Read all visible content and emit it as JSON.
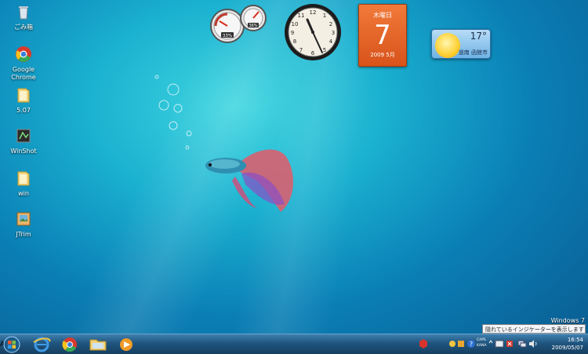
{
  "desktop": {
    "icons": [
      {
        "label": "ごみ箱",
        "icon": "recycle-bin-icon"
      },
      {
        "label": "Google Chrome",
        "icon": "chrome-icon"
      },
      {
        "label": "5.07",
        "icon": "folder-icon"
      },
      {
        "label": "WinShot",
        "icon": "winshot-icon"
      },
      {
        "label": "win",
        "icon": "folder-icon"
      },
      {
        "label": "JTrim",
        "icon": "jtrim-icon"
      }
    ],
    "watermark": "Windows 7"
  },
  "gadgets": {
    "meter": {
      "cpu": "33%",
      "memory": "36%"
    },
    "clock": {
      "hour": 11,
      "minute": 54
    },
    "calendar": {
      "weekday": "木曜日",
      "day": "7",
      "year_month": "2009 5月"
    },
    "weather": {
      "temp": "17°",
      "city": "道南 函館市"
    }
  },
  "tooltip": "隠れているインジケーターを表示します",
  "taskbar": {
    "pinned": [
      "start-orb",
      "internet-explorer",
      "chrome",
      "explorer",
      "media-player"
    ],
    "tray": {
      "ime": "A 般",
      "caps": "CAPS",
      "kana": "KANA",
      "time": "16:54",
      "date": "2009/05/07"
    }
  },
  "colors": {
    "accent": "#0a7fb5",
    "calendar": "#e8652a",
    "taskbar": "#1f557f"
  }
}
